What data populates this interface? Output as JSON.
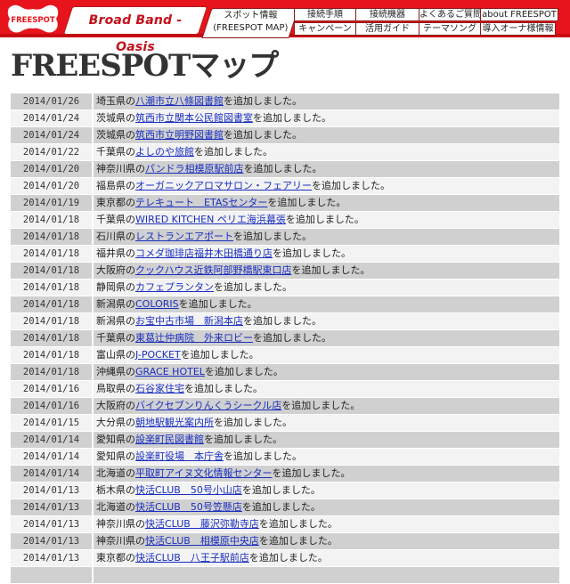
{
  "header": {
    "logo_text": "FREESPOT",
    "brand": "Broad Band - Oasis",
    "nav_first": {
      "line1": "スポット情報",
      "line2": "(FREESPOT MAP)"
    },
    "nav_items": [
      {
        "top": "接続手順",
        "bottom": "キャンペーン"
      },
      {
        "top": "接続機器",
        "bottom": "活用ガイド"
      },
      {
        "top": "よくあるご質問",
        "bottom": "テーマソング"
      },
      {
        "top": "about FREESPOT",
        "bottom": "導入オーナ様情報"
      }
    ]
  },
  "page_title": "FREESPOTマップ",
  "colors": {
    "brand_red": "#e8141c",
    "link": "#1a2fbf",
    "row_dark": "#d0d0d0",
    "row_light": "#f3f3f3"
  },
  "entries": [
    {
      "date": "2014/01/26",
      "pref": "埼玉県の",
      "name": "八潮市立八條図書館",
      "suffix": "を追加しました。"
    },
    {
      "date": "2014/01/24",
      "pref": "茨城県の",
      "name": "筑西市立関本公民館図書室",
      "suffix": "を追加しました。"
    },
    {
      "date": "2014/01/24",
      "pref": "茨城県の",
      "name": "筑西市立明野図書館",
      "suffix": "を追加しました。"
    },
    {
      "date": "2014/01/22",
      "pref": "千葉県の",
      "name": "よしのや旅館",
      "suffix": "を追加しました。"
    },
    {
      "date": "2014/01/20",
      "pref": "神奈川県の",
      "name": "パンドラ相模原駅前店",
      "suffix": "を追加しました。"
    },
    {
      "date": "2014/01/20",
      "pref": "福島県の",
      "name": "オーガニックアロマサロン・フェアリー",
      "suffix": "を追加しました。"
    },
    {
      "date": "2014/01/19",
      "pref": "東京都の",
      "name": "テレキュート　ETASセンター",
      "suffix": "を追加しました。"
    },
    {
      "date": "2014/01/18",
      "pref": "千葉県の",
      "name": "WIRED KITCHEN ペリエ海浜幕張",
      "suffix": "を追加しました。"
    },
    {
      "date": "2014/01/18",
      "pref": "石川県の",
      "name": "レストランエアポート",
      "suffix": "を追加しました。"
    },
    {
      "date": "2014/01/18",
      "pref": "福井県の",
      "name": "コメダ珈琲店福井木田橋通り店",
      "suffix": "を追加しました。"
    },
    {
      "date": "2014/01/18",
      "pref": "大阪府の",
      "name": "クックハウス近鉄阿部野橋駅東口店",
      "suffix": "を追加しました。"
    },
    {
      "date": "2014/01/18",
      "pref": "静岡県の",
      "name": "カフェプランタン",
      "suffix": "を追加しました。"
    },
    {
      "date": "2014/01/18",
      "pref": "新潟県の",
      "name": "COLORIS",
      "suffix": "を追加しました。"
    },
    {
      "date": "2014/01/18",
      "pref": "新潟県の",
      "name": "お宝中古市場　新潟本店",
      "suffix": "を追加しました。"
    },
    {
      "date": "2014/01/18",
      "pref": "千葉県の",
      "name": "東葛辻仲病院　外来ロビー",
      "suffix": "を追加しました。"
    },
    {
      "date": "2014/01/18",
      "pref": "富山県の",
      "name": "J-POCKET",
      "suffix": "を追加しました。"
    },
    {
      "date": "2014/01/18",
      "pref": "沖縄県の",
      "name": "GRACE HOTEL",
      "suffix": "を追加しました。"
    },
    {
      "date": "2014/01/16",
      "pref": "鳥取県の",
      "name": "石谷家住宅",
      "suffix": "を追加しました。"
    },
    {
      "date": "2014/01/16",
      "pref": "大阪府の",
      "name": "バイクセブンりんくうシークル店",
      "suffix": "を追加しました。"
    },
    {
      "date": "2014/01/15",
      "pref": "大分県の",
      "name": "朝地駅観光案内所",
      "suffix": "を追加しました。"
    },
    {
      "date": "2014/01/14",
      "pref": "愛知県の",
      "name": "設楽町民図書館",
      "suffix": "を追加しました。"
    },
    {
      "date": "2014/01/14",
      "pref": "愛知県の",
      "name": "設楽町役場　本庁舎",
      "suffix": "を追加しました。"
    },
    {
      "date": "2014/01/14",
      "pref": "北海道の",
      "name": "平取町アイヌ文化情報センター",
      "suffix": "を追加しました。"
    },
    {
      "date": "2014/01/13",
      "pref": "栃木県の",
      "name": "快活CLUB　50号小山店",
      "suffix": "を追加しました。"
    },
    {
      "date": "2014/01/13",
      "pref": "北海道の",
      "name": "快活CLUB　50号笠懸店",
      "suffix": "を追加しました。"
    },
    {
      "date": "2014/01/13",
      "pref": "神奈川県の",
      "name": "快活CLUB　藤沢弥勒寺店",
      "suffix": "を追加しました。"
    },
    {
      "date": "2014/01/13",
      "pref": "神奈川県の",
      "name": "快活CLUB　相模原中央店",
      "suffix": "を追加しました。"
    },
    {
      "date": "2014/01/13",
      "pref": "東京都の",
      "name": "快活CLUB　八王子駅前店",
      "suffix": "を追加しました。"
    },
    {
      "date": "",
      "pref": "",
      "name": "",
      "suffix": ""
    }
  ]
}
